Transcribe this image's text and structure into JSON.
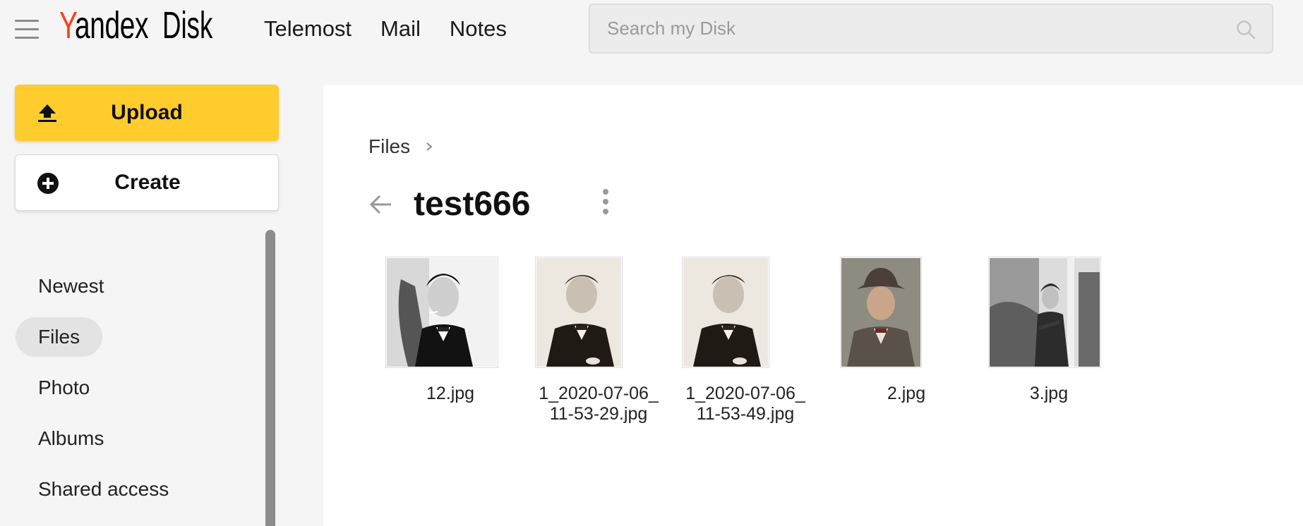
{
  "header": {
    "logo_y": "Y",
    "logo_rest": "andex",
    "logo_disk": "Disk",
    "nav": [
      "Telemost",
      "Mail",
      "Notes"
    ],
    "search_placeholder": "Search my Disk"
  },
  "sidebar": {
    "upload_label": "Upload",
    "create_label": "Create",
    "items": [
      {
        "label": "Newest",
        "active": false
      },
      {
        "label": "Files",
        "active": true
      },
      {
        "label": "Photo",
        "active": false
      },
      {
        "label": "Albums",
        "active": false
      },
      {
        "label": "Shared access",
        "active": false
      }
    ]
  },
  "main": {
    "breadcrumb": "Files",
    "title": "test666",
    "files": [
      {
        "name": "12.jpg"
      },
      {
        "name": "1_2020-07-06_\n11-53-29.jpg"
      },
      {
        "name": "1_2020-07-06_\n11-53-49.jpg"
      },
      {
        "name": "2.jpg"
      },
      {
        "name": "3.jpg"
      }
    ]
  },
  "colors": {
    "accent_yellow": "#ffcc2e",
    "logo_red": "#fc3f1d",
    "active_item_bg": "#e3e3e3"
  }
}
